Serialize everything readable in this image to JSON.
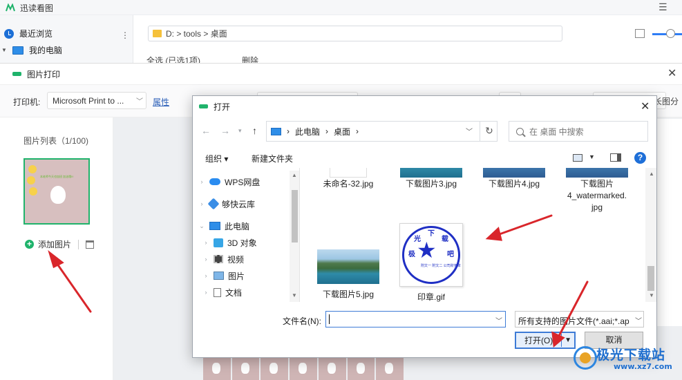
{
  "app": {
    "title": "迅读看图",
    "menu_icon": "hamburger-icon"
  },
  "sidebar": {
    "items": [
      {
        "label": "最近浏览",
        "icon": "clock-icon"
      },
      {
        "label": "我的电脑",
        "icon": "computer-icon"
      }
    ],
    "more": "⋮"
  },
  "pathbar": {
    "path": "D: > tools > 桌面"
  },
  "selection": {
    "select_all": "全选 (已选1项)",
    "delete": "删除"
  },
  "print_dialog": {
    "title": "图片打印",
    "close": "✕",
    "printer_label": "打印机:",
    "printer_value": "Microsoft Print to ...",
    "properties": "属性",
    "list_title": "图片列表（1/100)",
    "add_image": "添加图片",
    "long_label": "长图分",
    "thumbnail_text": "本老师今天也加班 加油哦!!!"
  },
  "open_dialog": {
    "title": "打开",
    "close": "✕",
    "breadcrumb": [
      "此电脑",
      "桌面"
    ],
    "search_placeholder": "在 桌面 中搜索",
    "organize": "组织",
    "new_folder": "新建文件夹",
    "help": "?",
    "nav_items": [
      {
        "label": "WPS网盘",
        "icon": "cloud-icon"
      },
      {
        "label": "够快云库",
        "icon": "cube-icon"
      },
      {
        "label": "此电脑",
        "icon": "computer-icon"
      },
      {
        "label": "3D 对象",
        "icon": "3d-objects-icon"
      },
      {
        "label": "视频",
        "icon": "video-icon"
      },
      {
        "label": "图片",
        "icon": "pictures-icon"
      },
      {
        "label": "文档",
        "icon": "documents-icon"
      }
    ],
    "files": [
      {
        "name": "未命名-32.jpg"
      },
      {
        "name": "下载图片3.jpg"
      },
      {
        "name": "下载图片4.jpg"
      },
      {
        "name": "下载图片4_watermarked.jpg",
        "lines": [
          "下载图片",
          "4_watermarked.",
          "jpg"
        ]
      },
      {
        "name": "下载图片5.jpg"
      },
      {
        "name": "印章.gif"
      }
    ],
    "stamp": {
      "chars": [
        "下",
        "载",
        "吧",
        "光",
        "极"
      ],
      "small_text": "附文一\n附文二\n公司财务章"
    },
    "filename_label": "文件名(N):",
    "filename_value": "",
    "filetype": "所有支持的图片文件(*.aai;*.ap",
    "open_button": "打开(O)",
    "cancel_button": "取消"
  },
  "watermark": {
    "name": "极光下载站",
    "url": "www.xz7.com"
  },
  "colors": {
    "accent_green": "#1fb36b",
    "arrow_red": "#d9262b",
    "selection_blue": "#3d7bd6"
  }
}
